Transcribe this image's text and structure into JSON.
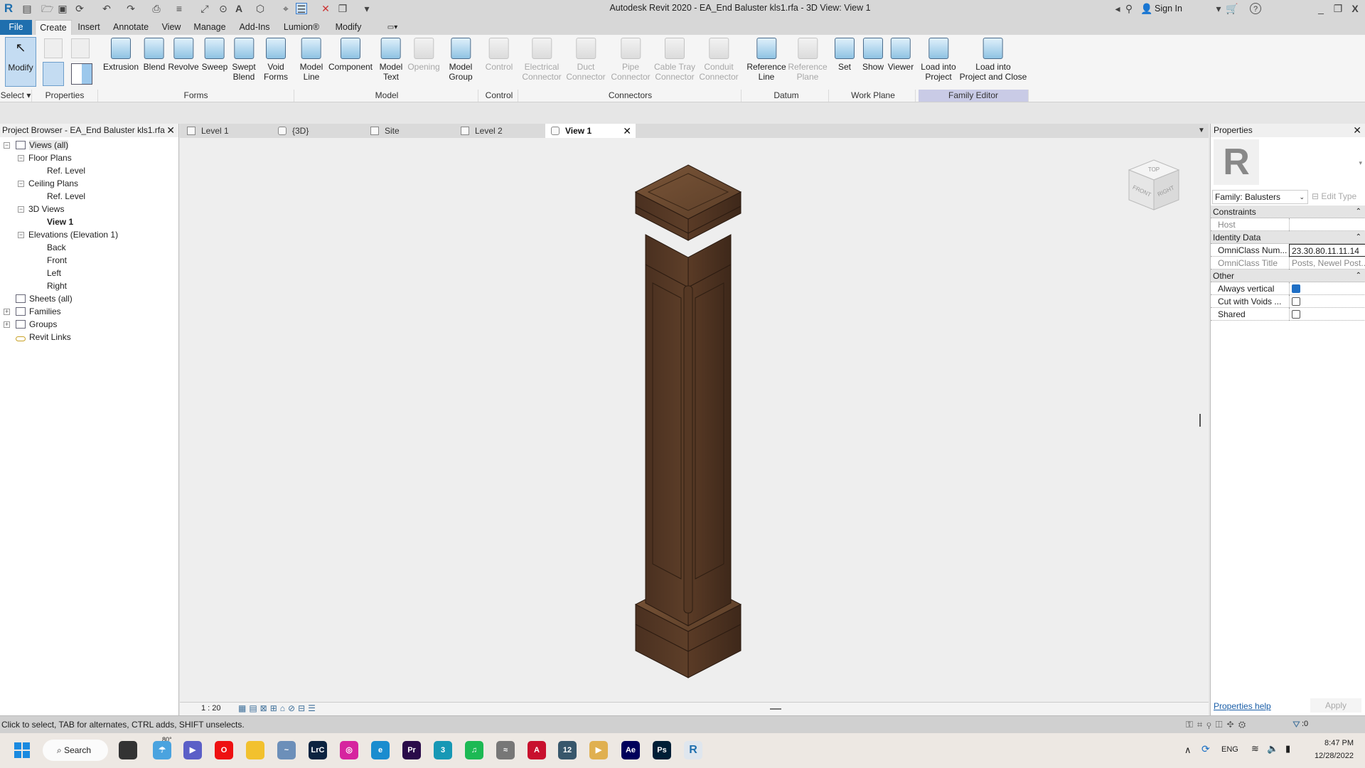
{
  "title": "Autodesk Revit 2020 - EA_End Baluster kls1.rfa - 3D View: View 1",
  "titlebar": {
    "sign_in": "Sign In",
    "minimize": "_",
    "restore": "❐",
    "close": "X"
  },
  "menu": {
    "file": "File",
    "tabs": [
      "Create",
      "Insert",
      "Annotate",
      "View",
      "Manage",
      "Add-Ins",
      "Lumion®",
      "Modify"
    ]
  },
  "ribbon": {
    "modify": "Modify",
    "buttons": [
      {
        "label": "Extrusion",
        "enabled": true
      },
      {
        "label": "Blend",
        "enabled": true
      },
      {
        "label": "Revolve",
        "enabled": true
      },
      {
        "label": "Sweep",
        "enabled": true
      },
      {
        "label": "Swept\nBlend",
        "enabled": true
      },
      {
        "label": "Void\nForms",
        "enabled": true
      },
      {
        "label": "Model\nLine",
        "enabled": true
      },
      {
        "label": "Component",
        "enabled": true
      },
      {
        "label": "Model\nText",
        "enabled": true
      },
      {
        "label": "Opening",
        "enabled": false
      },
      {
        "label": "Model\nGroup",
        "enabled": true
      },
      {
        "label": "Control",
        "enabled": false
      },
      {
        "label": "Electrical\nConnector",
        "enabled": false
      },
      {
        "label": "Duct\nConnector",
        "enabled": false
      },
      {
        "label": "Pipe\nConnector",
        "enabled": false
      },
      {
        "label": "Cable Tray\nConnector",
        "enabled": false
      },
      {
        "label": "Conduit\nConnector",
        "enabled": false
      },
      {
        "label": "Reference\nLine",
        "enabled": true
      },
      {
        "label": "Reference\nPlane",
        "enabled": false
      },
      {
        "label": "Set",
        "enabled": true
      },
      {
        "label": "Show",
        "enabled": true
      },
      {
        "label": "Viewer",
        "enabled": true
      },
      {
        "label": "Load into\nProject",
        "enabled": true
      },
      {
        "label": "Load into\nProject and Close",
        "enabled": true
      }
    ],
    "panels": [
      "Select ▾",
      "Properties",
      "Forms",
      "Model",
      "Control",
      "Connectors",
      "Datum",
      "Work Plane",
      "Family Editor"
    ]
  },
  "project_browser": {
    "title": "Project Browser - EA_End Baluster kls1.rfa",
    "items": [
      {
        "label": "Views (all)",
        "level": 0,
        "exp": "−"
      },
      {
        "label": "Floor Plans",
        "level": 1,
        "exp": "−"
      },
      {
        "label": "Ref. Level",
        "level": 2
      },
      {
        "label": "Ceiling Plans",
        "level": 1,
        "exp": "−"
      },
      {
        "label": "Ref. Level",
        "level": 2
      },
      {
        "label": "3D Views",
        "level": 1,
        "exp": "−"
      },
      {
        "label": "View 1",
        "level": 2,
        "bold": true
      },
      {
        "label": "Elevations (Elevation 1)",
        "level": 1,
        "exp": "−"
      },
      {
        "label": "Back",
        "level": 2
      },
      {
        "label": "Front",
        "level": 2
      },
      {
        "label": "Left",
        "level": 2
      },
      {
        "label": "Right",
        "level": 2
      },
      {
        "label": "Sheets (all)",
        "level": 0
      },
      {
        "label": "Families",
        "level": 0,
        "exp": "+"
      },
      {
        "label": "Groups",
        "level": 0,
        "exp": "+"
      },
      {
        "label": "Revit Links",
        "level": 0
      }
    ]
  },
  "view_tabs": [
    {
      "label": "Level 1"
    },
    {
      "label": "{3D}"
    },
    {
      "label": "Site"
    },
    {
      "label": "Level 2"
    },
    {
      "label": "View 1",
      "active": true
    }
  ],
  "viewcube": {
    "top": "TOP",
    "front": "FRONT",
    "right": "RIGHT"
  },
  "view_bar": {
    "scale": "1 : 20"
  },
  "properties": {
    "title": "Properties",
    "family": "Family: Balusters",
    "edit_type": "Edit Type",
    "constraints": "Constraints",
    "host": "Host",
    "identity": "Identity Data",
    "omni_num_k": "OmniClass Num...",
    "omni_num_v": "23.30.80.11.11.14",
    "omni_title_k": "OmniClass Title",
    "omni_title_v": "Posts, Newel Post...",
    "other": "Other",
    "always_vertical": "Always vertical",
    "always_vertical_checked": true,
    "cut_voids": "Cut with Voids ...",
    "cut_voids_checked": false,
    "shared": "Shared",
    "shared_checked": false,
    "help": "Properties help",
    "apply": "Apply"
  },
  "status": {
    "text": "Click to select, TAB for alternates, CTRL adds, SHIFT unselects.",
    "filter_count": ":0"
  },
  "taskbar": {
    "search": "Search",
    "weather": "80°",
    "lang": "ENG",
    "time": "8:47 PM",
    "date": "12/28/2022",
    "apps": [
      {
        "name": "task-view",
        "t": "",
        "c": "#333"
      },
      {
        "name": "weather",
        "t": "☂",
        "c": "#4aa3df"
      },
      {
        "name": "teams-chat",
        "t": "▶",
        "c": "#5b5fc7"
      },
      {
        "name": "opera",
        "t": "O",
        "c": "#e11"
      },
      {
        "name": "file-explorer",
        "t": "",
        "c": "#f2c12e"
      },
      {
        "name": "performance-monitor",
        "t": "~",
        "c": "#6c8fb9"
      },
      {
        "name": "lightroom-classic",
        "t": "LrC",
        "c": "#0c2340"
      },
      {
        "name": "instagram",
        "t": "◎",
        "c": "#d6249f"
      },
      {
        "name": "edge",
        "t": "e",
        "c": "#1a8ccf"
      },
      {
        "name": "premiere",
        "t": "Pr",
        "c": "#2a0b4a"
      },
      {
        "name": "3ds-max",
        "t": "3",
        "c": "#1798b5"
      },
      {
        "name": "spotify",
        "t": "♫",
        "c": "#1db954"
      },
      {
        "name": "autodesk-app",
        "t": "≈",
        "c": "#777"
      },
      {
        "name": "autocad",
        "t": "A",
        "c": "#c8102e"
      },
      {
        "name": "sketch-12",
        "t": "12",
        "c": "#38576b"
      },
      {
        "name": "media-player",
        "t": "▶",
        "c": "#e0b050"
      },
      {
        "name": "after-effects",
        "t": "Ae",
        "c": "#00005b"
      },
      {
        "name": "photoshop",
        "t": "Ps",
        "c": "#001e36"
      },
      {
        "name": "revit",
        "t": "R",
        "c": "#dfe6ee"
      }
    ]
  }
}
